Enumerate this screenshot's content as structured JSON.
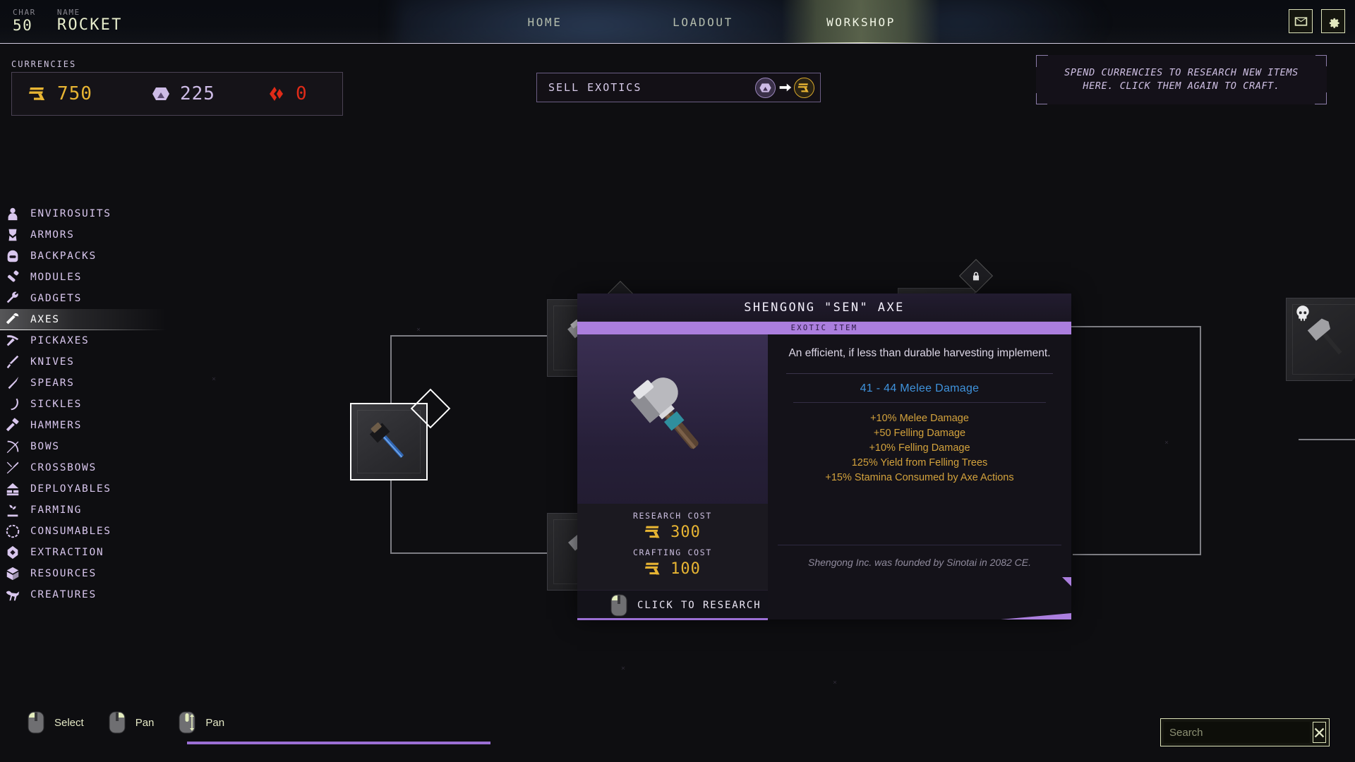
{
  "header": {
    "char_label": "CHAR",
    "char_value": "50",
    "name_label": "NAME",
    "name_value": "ROCKET",
    "tabs": [
      {
        "label": "HOME",
        "active": false
      },
      {
        "label": "LOADOUT",
        "active": false
      },
      {
        "label": "WORKSHOP",
        "active": true
      }
    ],
    "mail_icon": "mail-icon",
    "settings_icon": "gear-icon"
  },
  "currencies": {
    "label": "CURRENCIES",
    "items": [
      {
        "icon": "rupee-currency-icon",
        "value": "750",
        "color": "#e8b533"
      },
      {
        "icon": "exotic-hex-icon",
        "value": "225",
        "color": "#cdbbe6"
      },
      {
        "icon": "red-gem-icon",
        "value": "0",
        "color": "#e02b18"
      }
    ]
  },
  "sell_exotics": {
    "label": "SELL EXOTICS",
    "from_icon": "exotic-hex-icon",
    "arrow_icon": "arrow-right-icon",
    "to_icon": "rupee-currency-icon"
  },
  "hint_box": {
    "text": "SPEND CURRENCIES TO RESEARCH NEW ITEMS HERE. CLICK THEM AGAIN TO CRAFT."
  },
  "sidebar": {
    "items": [
      {
        "label": "ENVIROSUITS",
        "icon": "envirosuit-icon",
        "selected": false
      },
      {
        "label": "ARMORS",
        "icon": "armor-icon",
        "selected": false
      },
      {
        "label": "BACKPACKS",
        "icon": "backpack-icon",
        "selected": false
      },
      {
        "label": "MODULES",
        "icon": "module-icon",
        "selected": false
      },
      {
        "label": "GADGETS",
        "icon": "wrench-icon",
        "selected": false
      },
      {
        "label": "AXES",
        "icon": "axe-icon",
        "selected": true
      },
      {
        "label": "PICKAXES",
        "icon": "pickaxe-icon",
        "selected": false
      },
      {
        "label": "KNIVES",
        "icon": "knife-icon",
        "selected": false
      },
      {
        "label": "SPEARS",
        "icon": "spear-icon",
        "selected": false
      },
      {
        "label": "SICKLES",
        "icon": "sickle-icon",
        "selected": false
      },
      {
        "label": "HAMMERS",
        "icon": "hammer-icon",
        "selected": false
      },
      {
        "label": "BOWS",
        "icon": "bow-icon",
        "selected": false
      },
      {
        "label": "CROSSBOWS",
        "icon": "crossbow-icon",
        "selected": false
      },
      {
        "label": "DEPLOYABLES",
        "icon": "deployable-icon",
        "selected": false
      },
      {
        "label": "FARMING",
        "icon": "farming-icon",
        "selected": false
      },
      {
        "label": "CONSUMABLES",
        "icon": "consumable-icon",
        "selected": false
      },
      {
        "label": "EXTRACTION",
        "icon": "extraction-icon",
        "selected": false
      },
      {
        "label": "RESOURCES",
        "icon": "resources-icon",
        "selected": false
      },
      {
        "label": "CREATURES",
        "icon": "creature-icon",
        "selected": false
      }
    ]
  },
  "item_panel": {
    "title": "SHENGONG \"SEN\" AXE",
    "rarity": "EXOTIC ITEM",
    "description": "An efficient, if less than durable harvesting implement.",
    "primary_stat": "41 - 44 Melee Damage",
    "perks": [
      "+10% Melee Damage",
      "+50 Felling Damage",
      "+10% Felling Damage",
      "125% Yield from Felling Trees",
      "+15% Stamina Consumed by Axe Actions"
    ],
    "flavor": "Shengong Inc. was founded by Sinotai in 2082 CE.",
    "research_cost_label": "RESEARCH COST",
    "research_cost_value": "300",
    "crafting_cost_label": "CRAFTING COST",
    "crafting_cost_value": "100",
    "action_label": "CLICK TO RESEARCH",
    "action_icon": "mouse-left-click-icon"
  },
  "bottom_bar": {
    "hints": [
      {
        "label": "Select",
        "icon": "mouse-left-click-icon"
      },
      {
        "label": "Pan",
        "icon": "mouse-right-click-icon"
      },
      {
        "label": "Pan",
        "icon": "mouse-scroll-icon"
      }
    ],
    "search": {
      "placeholder": "Search",
      "value": "",
      "clear_icon": "close-x-icon"
    }
  },
  "graph": {
    "nodes": [
      {
        "name": "locked-axe-node-1",
        "locked": true
      },
      {
        "name": "selected-axe-node",
        "locked": false
      },
      {
        "name": "locked-axe-node-2",
        "locked": true
      },
      {
        "name": "locked-axe-node-3",
        "locked": true
      },
      {
        "name": "exotic-axe-node",
        "locked": false
      }
    ]
  }
}
